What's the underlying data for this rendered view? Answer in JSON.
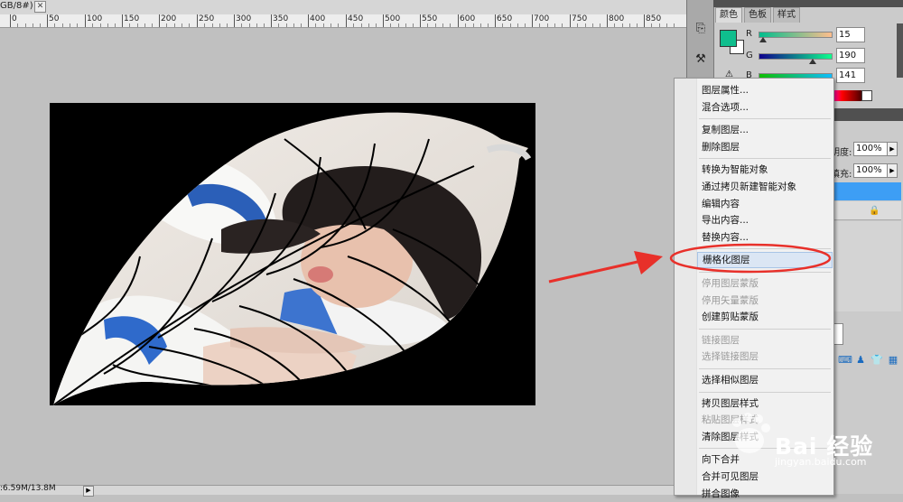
{
  "document": {
    "tab_title": "GB/8#) *",
    "close_glyph": "✕",
    "status_text": ":6.59M/13.8M",
    "status_arrow": "▶"
  },
  "ruler": {
    "labels": [
      "0",
      "50",
      "100",
      "150",
      "200",
      "250",
      "300",
      "350",
      "400",
      "450",
      "500",
      "550",
      "600",
      "650",
      "700",
      "750",
      "800",
      "850"
    ]
  },
  "panels": {
    "tabs": [
      "颜色",
      "色板",
      "样式"
    ],
    "color": {
      "r_label": "R",
      "r_value": "15",
      "g_label": "G",
      "g_value": "190",
      "b_label": "B",
      "b_value": "141",
      "swatch": "#0fbe8d"
    },
    "layers": {
      "opacity_label": "明度:",
      "opacity_value": "100%",
      "fill_label": "填充:",
      "fill_value": "100%"
    },
    "dock_icons": [
      "history-icon",
      "brush-presets-icon"
    ]
  },
  "context_menu": {
    "items": [
      {
        "label": "图层属性...",
        "disabled": false
      },
      {
        "label": "混合选项...",
        "disabled": false
      },
      {
        "sep": true
      },
      {
        "label": "复制图层...",
        "disabled": false
      },
      {
        "label": "删除图层",
        "disabled": false
      },
      {
        "sep": true
      },
      {
        "label": "转换为智能对象",
        "disabled": false
      },
      {
        "label": "通过拷贝新建智能对象",
        "disabled": false
      },
      {
        "label": "编辑内容",
        "disabled": false
      },
      {
        "label": "导出内容...",
        "disabled": false
      },
      {
        "label": "替换内容...",
        "disabled": false
      },
      {
        "sep": true
      },
      {
        "label": "栅格化图层",
        "disabled": false,
        "highlighted": true
      },
      {
        "sep": true
      },
      {
        "label": "停用图层蒙版",
        "disabled": true
      },
      {
        "label": "停用矢量蒙版",
        "disabled": true
      },
      {
        "label": "创建剪贴蒙版",
        "disabled": false
      },
      {
        "sep": true
      },
      {
        "label": "链接图层",
        "disabled": true
      },
      {
        "label": "选择链接图层",
        "disabled": true
      },
      {
        "sep": true
      },
      {
        "label": "选择相似图层",
        "disabled": false
      },
      {
        "sep": true
      },
      {
        "label": "拷贝图层样式",
        "disabled": false
      },
      {
        "label": "粘贴图层样式",
        "disabled": true
      },
      {
        "label": "清除图层样式",
        "disabled": false
      },
      {
        "sep": true
      },
      {
        "label": "向下合并",
        "disabled": false
      },
      {
        "label": "合并可见图层",
        "disabled": false
      },
      {
        "label": "拼合图像",
        "disabled": false
      }
    ]
  },
  "watermark": {
    "brand": "Bai 经验",
    "url": "jingyan.baidu.com"
  },
  "colors": {
    "annotation_red": "#e8302a",
    "menu_highlight": "#dbe6f4",
    "layer_selected": "#3d9ef5"
  }
}
